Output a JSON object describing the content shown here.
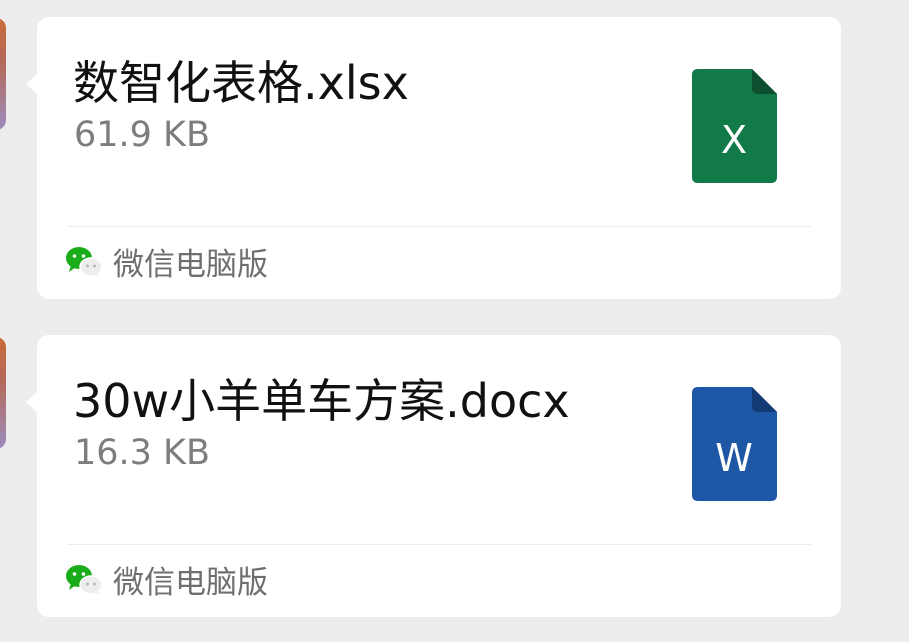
{
  "messages": [
    {
      "file_name": "数智化表格.xlsx",
      "file_size": "61.9 KB",
      "file_type": "excel",
      "file_icon_letter": "X",
      "file_icon_color": "#117a48",
      "source_label": "微信电脑版"
    },
    {
      "file_name": "30w小羊单车方案.docx",
      "file_size": "16.3 KB",
      "file_type": "word",
      "file_icon_letter": "W",
      "file_icon_color": "#1d57a6",
      "source_label": "微信电脑版"
    }
  ],
  "colors": {
    "background": "#ededed",
    "bubble": "#ffffff",
    "wechat_green": "#1aad19"
  }
}
